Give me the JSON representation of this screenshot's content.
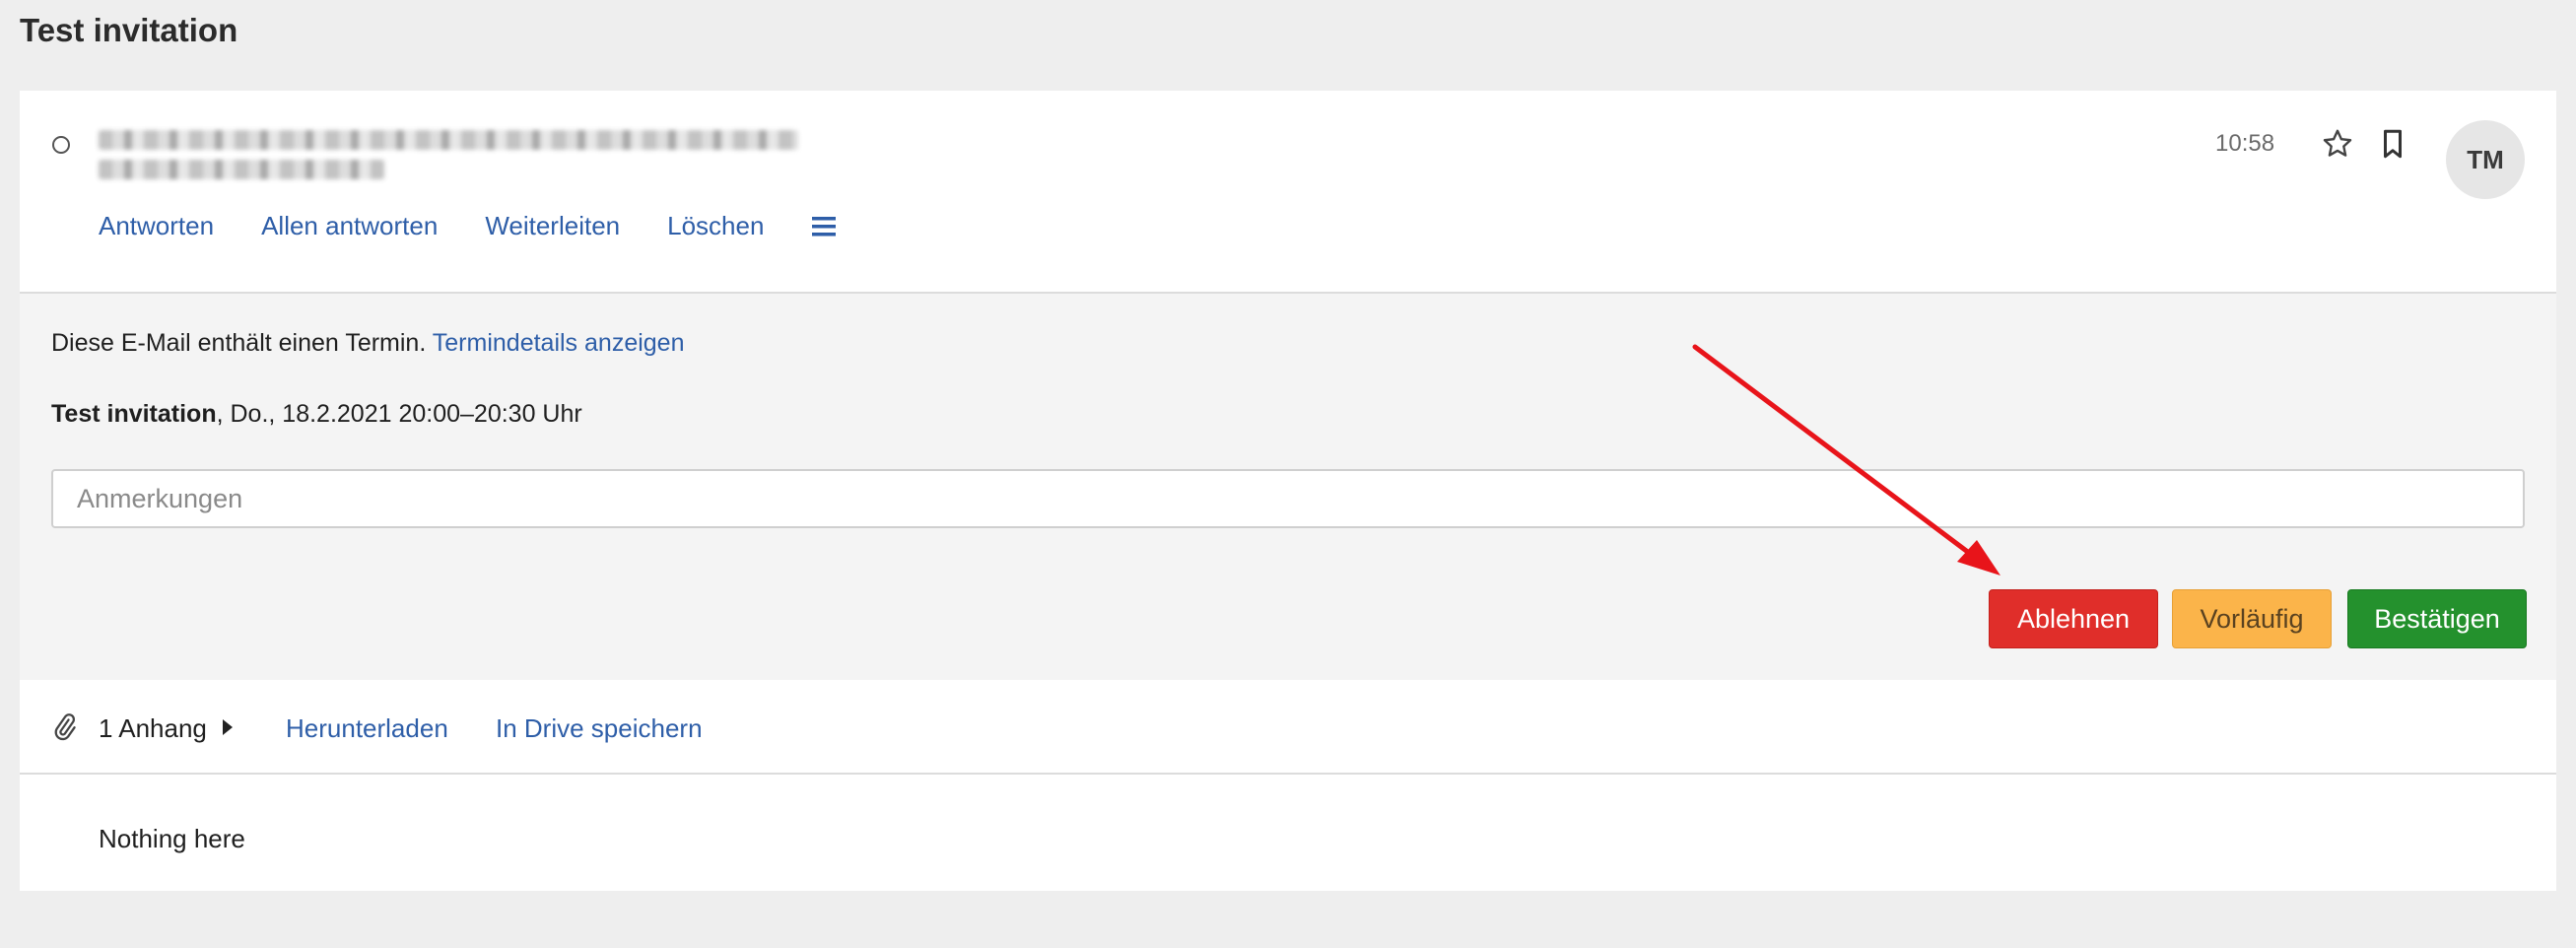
{
  "page": {
    "title": "Test invitation"
  },
  "mail": {
    "time": "10:58",
    "avatar_initials": "TM",
    "actions": {
      "reply": "Antworten",
      "reply_all": "Allen antworten",
      "forward": "Weiterleiten",
      "delete": "Löschen"
    }
  },
  "invitation": {
    "note_text": "Diese E-Mail enthält einen Termin.",
    "details_link": "Termindetails anzeigen",
    "event_title": "Test invitation",
    "event_when": ", Do., 18.2.2021 20:00–20:30 Uhr",
    "comment_placeholder": "Anmerkungen",
    "buttons": {
      "decline": "Ablehnen",
      "tentative": "Vorläufig",
      "accept": "Bestätigen"
    }
  },
  "attachments": {
    "count_label": "1 Anhang",
    "download": "Herunterladen",
    "save_drive": "In Drive speichern"
  },
  "body": {
    "text": "Nothing here"
  },
  "colors": {
    "link": "#2e5ea8",
    "decline": "#e02e2a",
    "tentative": "#fbb44a",
    "accept": "#24912d",
    "annotation_arrow": "#e8141a"
  },
  "icons": [
    "unread-indicator-icon",
    "star-icon",
    "bookmark-icon",
    "hamburger-menu-icon",
    "paperclip-icon",
    "caret-right-icon",
    "annotation-arrow"
  ]
}
